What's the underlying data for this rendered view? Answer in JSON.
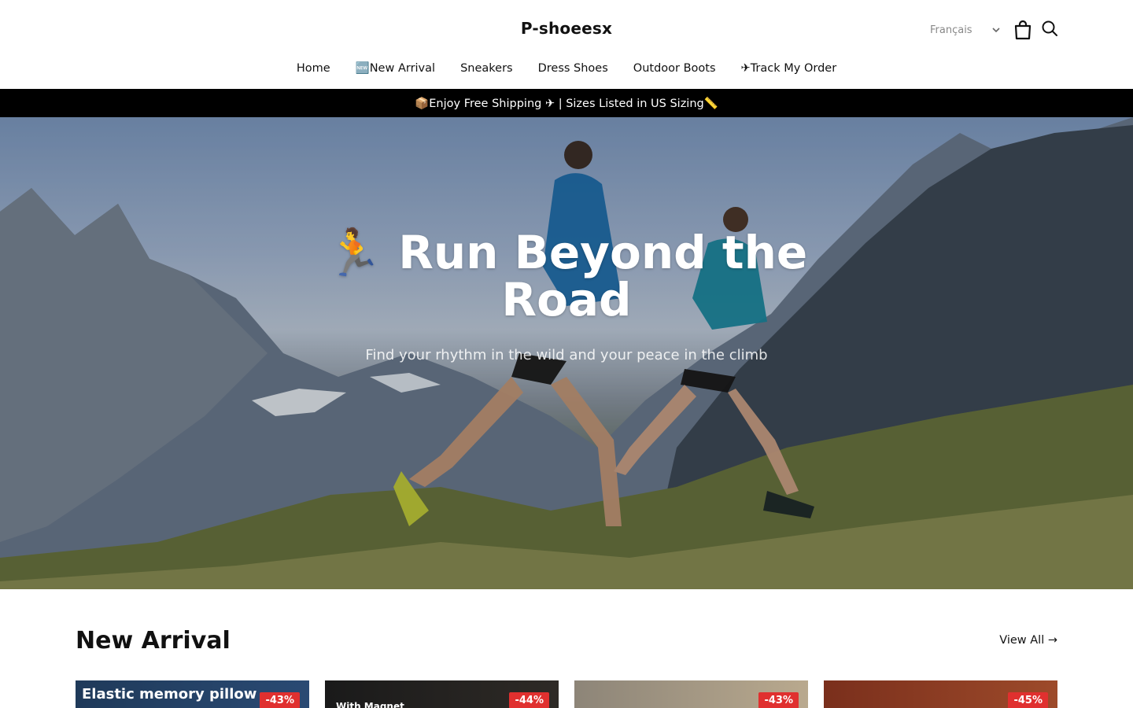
{
  "header": {
    "brand": "P-shoeesx",
    "language": "Français"
  },
  "nav": {
    "items": [
      "Home",
      "🆕New Arrival",
      "Sneakers",
      "Dress Shoes",
      "Outdoor Boots",
      "✈Track My Order"
    ]
  },
  "announcement": "📦Enjoy Free Shipping ✈ | Sizes Listed in US Sizing📏",
  "hero": {
    "title": "🏃 Run Beyond the Road",
    "subtitle": "Find your rhythm in the wild and your peace in the climb"
  },
  "new_arrival": {
    "title": "New Arrival",
    "view_all": "View All →",
    "products": [
      {
        "label": "Elastic memory pillow",
        "discount": "-43%"
      },
      {
        "label": "With Magnet",
        "discount": "-44%"
      },
      {
        "label": "",
        "discount": "-43%"
      },
      {
        "label": "",
        "discount": "-45%"
      }
    ]
  },
  "colors": {
    "announcement_bg": "#000000",
    "badge": "#e0302f"
  },
  "icons": [
    "chevron-down-icon",
    "shopping-bag-icon",
    "search-icon"
  ]
}
